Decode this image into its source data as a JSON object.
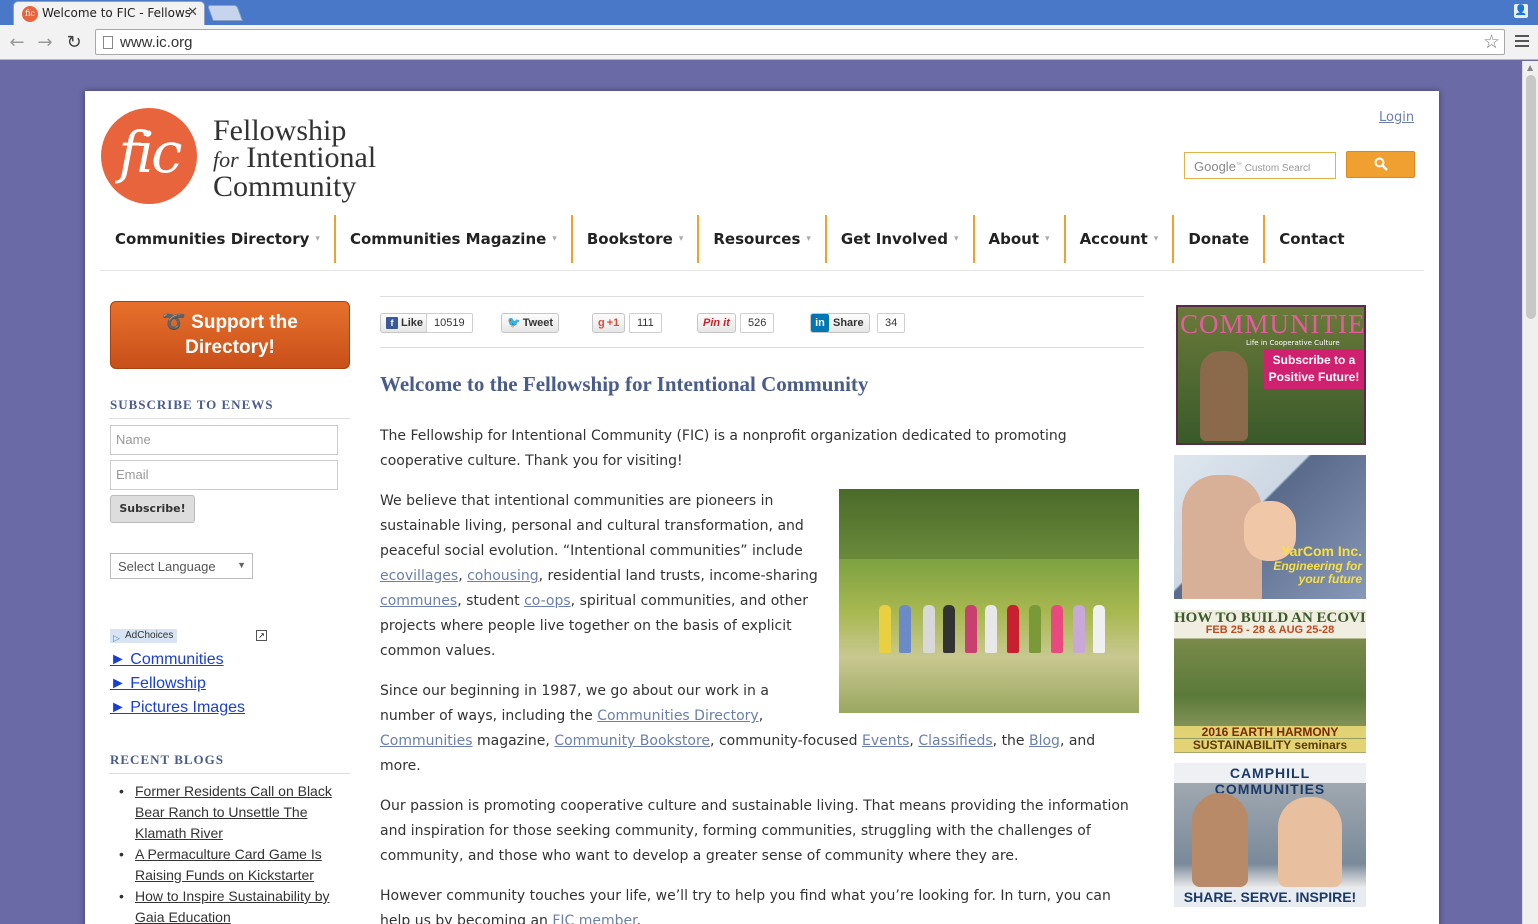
{
  "browser": {
    "tab_title": "Welcome to FIC - Fellowship",
    "url": "www.ic.org"
  },
  "logo": {
    "mark": "fic",
    "line1": "Fellowship",
    "line2_for": "for",
    "line2": "Intentional",
    "line3": "Community"
  },
  "header": {
    "login": "Login",
    "search_placeholder_brand": "Google",
    "search_placeholder": "Custom Searcl",
    "search_button_icon": "search-icon"
  },
  "nav": {
    "items": [
      {
        "label": "Communities Directory",
        "dropdown": true
      },
      {
        "label": "Communities Magazine",
        "dropdown": true
      },
      {
        "label": "Bookstore",
        "dropdown": true
      },
      {
        "label": "Resources",
        "dropdown": true
      },
      {
        "label": "Get Involved",
        "dropdown": true
      },
      {
        "label": "About",
        "dropdown": true
      },
      {
        "label": "Account",
        "dropdown": true
      },
      {
        "label": "Donate",
        "dropdown": false
      },
      {
        "label": "Contact",
        "dropdown": false
      }
    ],
    "accent_color": "#f0a030"
  },
  "sidebar": {
    "support_line1": "Support the",
    "support_line2": "Directory!",
    "subscribe_heading": "SUBSCRIBE TO ENEWS",
    "name_placeholder": "Name",
    "email_placeholder": "Email",
    "subscribe_button": "Subscribe!",
    "language_select": "Select Language",
    "adchoices": "AdChoices",
    "ad_links": [
      "► Communities",
      "► Fellowship",
      "► Pictures Images"
    ],
    "recent_heading": "RECENT BLOGS",
    "recent_blogs": [
      "Former Residents Call on Black Bear Ranch to Unsettle The Klamath River",
      "A Permaculture Card Game Is Raising Funds on Kickstarter",
      "How to Inspire Sustainability by Gaia Education"
    ]
  },
  "social": {
    "like_label": "Like",
    "like_count": "10519",
    "tweet_label": "Tweet",
    "gplus_label": "+1",
    "gplus_count": "111",
    "pin_label": "Pin it",
    "pin_count": "526",
    "share_label": "Share",
    "share_count": "34"
  },
  "main": {
    "title": "Welcome to the Fellowship for Intentional Community",
    "p1": "The Fellowship for Intentional Community (FIC) is a nonprofit organization dedicated to promoting cooperative culture. Thank you for visiting!",
    "p2_a": "We believe that intentional communities are pioneers in sustainable living, personal and cultural transformation, and peaceful social evolution. “Intentional communities” include ",
    "p2_link1": "ecovillages",
    "p2_b": ", ",
    "p2_link2": "cohousing",
    "p2_c": ", residential land trusts, income-sharing ",
    "p2_link3": "communes",
    "p2_d": ", student ",
    "p2_link4": "co-ops",
    "p2_e": ", spiritual communities, and other projects where people live together on the basis of explicit common values.",
    "p3_a": "Since our beginning in 1987, we go about our work in a number of ways, including the ",
    "p3_link1": "Communities Directory",
    "p3_b": ", ",
    "p3_link2": "Communities",
    "p3_c": " magazine, ",
    "p3_link3": "Community Bookstore",
    "p3_d": ", community-focused ",
    "p3_link4": "Events",
    "p3_e": ", ",
    "p3_link5": "Classifieds",
    "p3_f": ", the ",
    "p3_link6": "Blog",
    "p3_g": ", and more.",
    "p4": "Our passion is promoting cooperative culture and sustainable living. That means providing the information and inspiration for those seeking community, forming communities, struggling with the challenges of community, and those who want to develop a greater sense of community where they are.",
    "p5_a": "However community touches your life, we’ll try to help you find what you’re looking for. In turn, you can help us by becoming an ",
    "p5_link": "FIC member",
    "p5_b": "."
  },
  "ads": {
    "ad1_title": "COMMUNITIES",
    "ad1_sub": "Life in Cooperative Culture",
    "ad1_badge_1": "Subscribe to a",
    "ad1_badge_2": "Positive Future!",
    "ad2_name": "YarCom Inc.",
    "ad2_tag": "Engineering for your future",
    "ad3_title": "HOW TO BUILD AN ECOVILLAGE",
    "ad3_dates": "FEB 25 - 28 & AUG 25-28",
    "ad3_footer1": "2016 EARTH HARMONY",
    "ad3_footer2": "SUSTAINABILITY seminars",
    "ad4_title": "CAMPHILL COMMUNITIES",
    "ad4_footer": "SHARE. SERVE. INSPIRE!"
  }
}
